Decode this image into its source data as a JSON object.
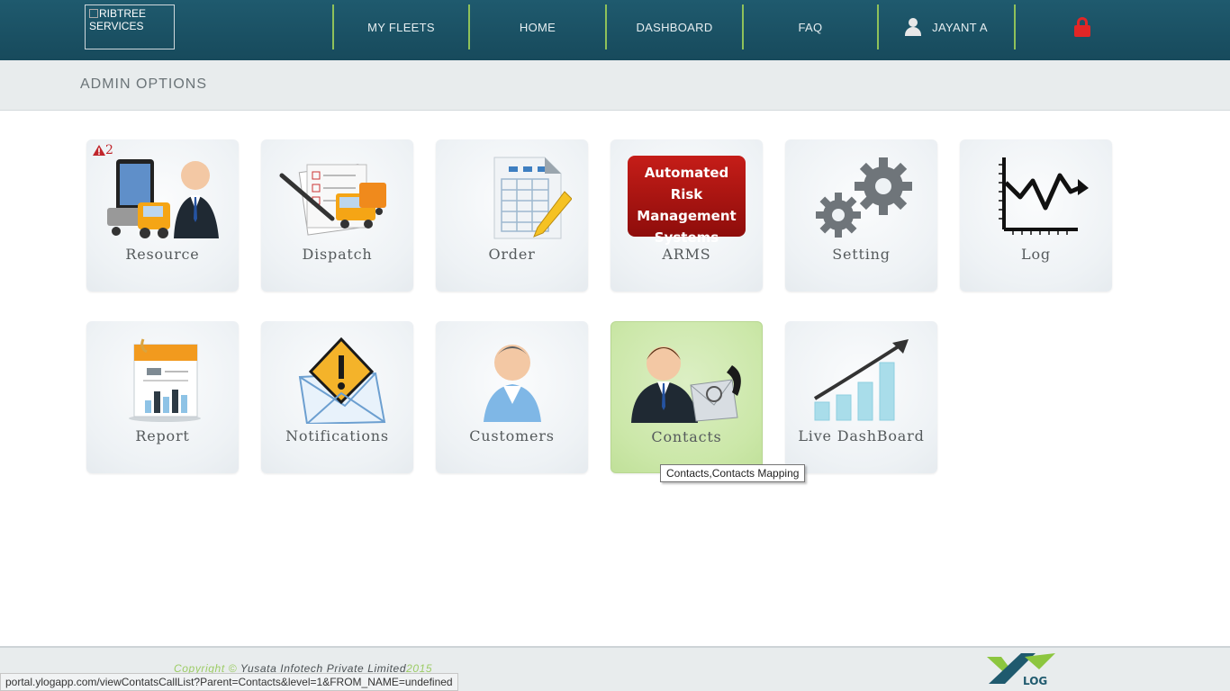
{
  "header": {
    "logo_alt_text": "RIBTREE SERVICES",
    "nav": {
      "my_fleets": "MY FLEETS",
      "home": "HOME",
      "dashboard": "DASHBOARD",
      "faq": "FAQ",
      "user": "JAYANT A"
    }
  },
  "subheader": {
    "title": "ADMIN OPTIONS"
  },
  "tiles": {
    "resource": {
      "label": "Resource",
      "badge_count": "2"
    },
    "dispatch": {
      "label": "Dispatch"
    },
    "order": {
      "label": "Order"
    },
    "arms": {
      "label": "ARMS",
      "banner_line1": "Automated Risk",
      "banner_line2": "Management",
      "banner_line3": "Systems"
    },
    "setting": {
      "label": "Setting"
    },
    "log": {
      "label": "Log"
    },
    "report": {
      "label": "Report"
    },
    "notifications": {
      "label": "Notifications"
    },
    "customers": {
      "label": "Customers"
    },
    "contacts": {
      "label": "Contacts"
    },
    "live_dashboard": {
      "label": "Live DashBoard"
    }
  },
  "tooltip": {
    "text": "Contacts,Contacts Mapping"
  },
  "footer": {
    "copyright_prefix": "Copyright ©",
    "company": "Yusata Infotech Private Limited",
    "year": "2015",
    "logo_text": "LOG"
  },
  "statusbar": {
    "url": "portal.ylogapp.com/viewContatsCallList?Parent=Contacts&level=1&FROM_NAME=undefined"
  },
  "colors": {
    "header_bg": "#1f5a6e",
    "nav_separator": "#8fc15a",
    "active_tile": "#cbe7a8",
    "lock": "#e32626",
    "arms_banner": "#a8120f"
  }
}
